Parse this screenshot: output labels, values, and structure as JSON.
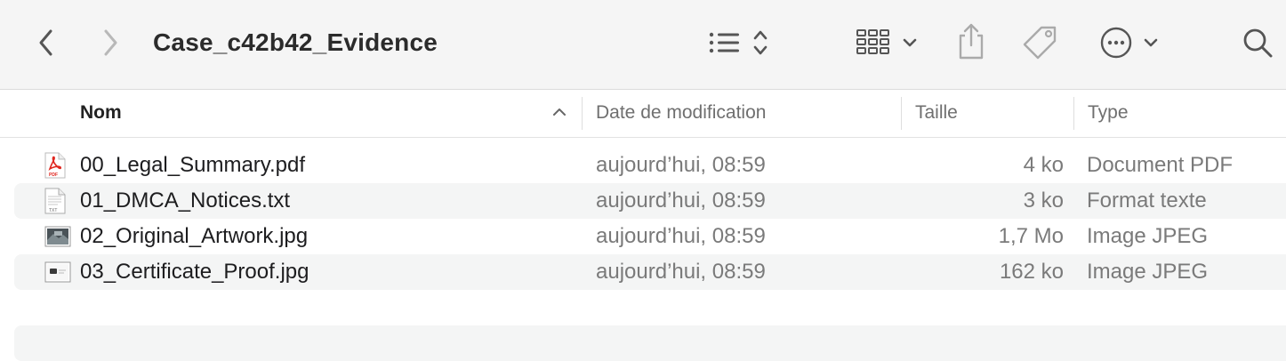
{
  "window": {
    "title": "Case_c42b42_Evidence"
  },
  "toolbar": {
    "back_icon": "chevron-left-icon",
    "forward_icon": "chevron-right-icon",
    "view_list_icon": "list-view-icon",
    "group_icon": "grid-group-icon",
    "share_icon": "share-icon",
    "tag_icon": "tag-icon",
    "more_icon": "ellipsis-circle-icon",
    "search_icon": "search-icon"
  },
  "columns": {
    "name": "Nom",
    "date": "Date de modification",
    "size": "Taille",
    "kind": "Type"
  },
  "files": [
    {
      "name": "00_Legal_Summary.pdf",
      "date": "aujourd’hui, 08:59",
      "size": "4 ko",
      "kind": "Document PDF",
      "icon": "pdf-file-icon"
    },
    {
      "name": "01_DMCA_Notices.txt",
      "date": "aujourd’hui, 08:59",
      "size": "3 ko",
      "kind": "Format texte",
      "icon": "txt-file-icon"
    },
    {
      "name": "02_Original_Artwork.jpg",
      "date": "aujourd’hui, 08:59",
      "size": "1,7 Mo",
      "kind": "Image JPEG",
      "icon": "jpeg-image-icon"
    },
    {
      "name": "03_Certificate_Proof.jpg",
      "date": "aujourd’hui, 08:59",
      "size": "162 ko",
      "kind": "Image JPEG",
      "icon": "jpeg-image-icon"
    }
  ],
  "colors": {
    "toolbar_bg": "#f5f5f5",
    "row_alt_bg": "#f4f5f5",
    "pdf_red": "#e0261f"
  }
}
